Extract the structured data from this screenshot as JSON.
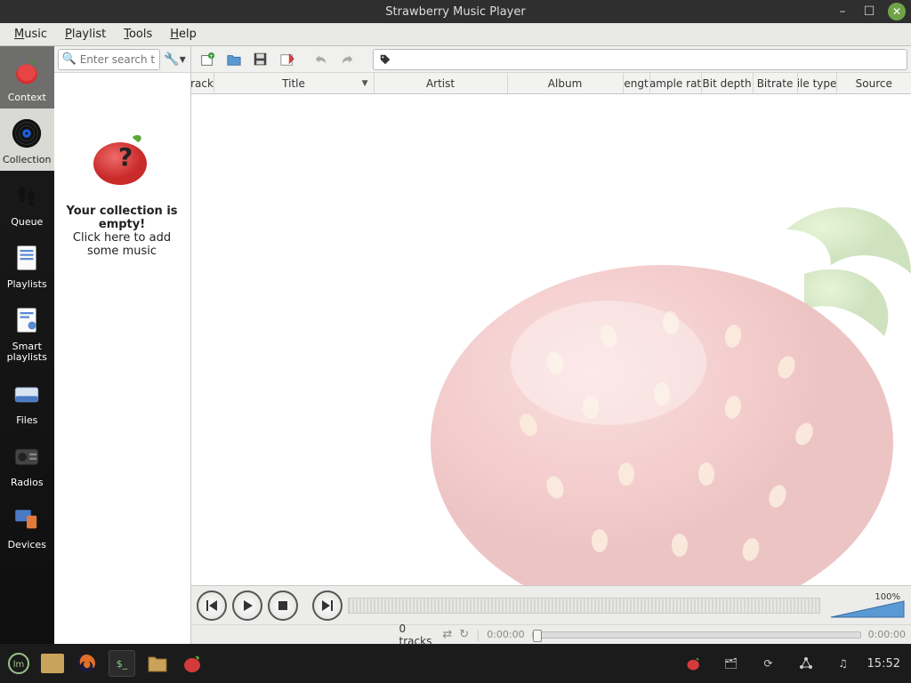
{
  "window": {
    "title": "Strawberry Music Player"
  },
  "menus": {
    "music": "Music",
    "playlist": "Playlist",
    "tools": "Tools",
    "help": "Help"
  },
  "nav": {
    "context": "Context",
    "collection": "Collection",
    "queue": "Queue",
    "playlists": "Playlists",
    "smart": "Smart playlists",
    "files": "Files",
    "radios": "Radios",
    "devices": "Devices"
  },
  "search": {
    "placeholder": "Enter search t…"
  },
  "collection_empty": {
    "heading": "Your collection is empty!",
    "subtext": "Click here to add some music"
  },
  "columns": {
    "track": "rack",
    "title": "Title",
    "artist": "Artist",
    "album": "Album",
    "length": "engt",
    "samplerate": "ample rat",
    "bitdepth": "Bit depth",
    "bitrate": "Bitrate",
    "filetype": "ile type",
    "source": "Source"
  },
  "volume": {
    "label": "100%"
  },
  "status": {
    "tracks": "0 tracks",
    "time_left": "0:00:00",
    "time_right": "0:00:00"
  },
  "taskbar": {
    "clock": "15:52"
  }
}
